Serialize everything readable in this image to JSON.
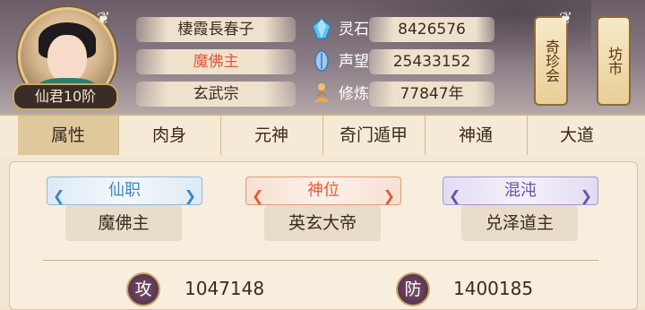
{
  "profile": {
    "rank": "仙君10阶",
    "names": [
      "棲霞長春子",
      "魔佛主",
      "玄武宗"
    ],
    "highlight_color": "#e4563a"
  },
  "stats": [
    {
      "label": "灵石",
      "value": "8426576",
      "icon": "spirit-stone-icon"
    },
    {
      "label": "声望",
      "value": "25433152",
      "icon": "reputation-icon"
    },
    {
      "label": "修炼",
      "value": "77847年",
      "icon": "meditation-icon"
    }
  ],
  "side_buttons": [
    {
      "label": "奇珍会"
    },
    {
      "label": "坊市"
    }
  ],
  "tabs": [
    {
      "label": "属性",
      "active": true
    },
    {
      "label": "肉身"
    },
    {
      "label": "元神"
    },
    {
      "label": "奇门遁甲"
    },
    {
      "label": "神通"
    },
    {
      "label": "大道"
    }
  ],
  "cards": [
    {
      "title": "仙职",
      "value": "魔佛主",
      "color": "#3a87c9"
    },
    {
      "title": "神位",
      "value": "英玄大帝",
      "color": "#e35b3a"
    },
    {
      "title": "混沌",
      "value": "兑泽道主",
      "color": "#6a52b0"
    }
  ],
  "attributes": [
    {
      "icon_label": "攻",
      "value": "1047148"
    },
    {
      "icon_label": "防",
      "value": "1400185"
    }
  ]
}
